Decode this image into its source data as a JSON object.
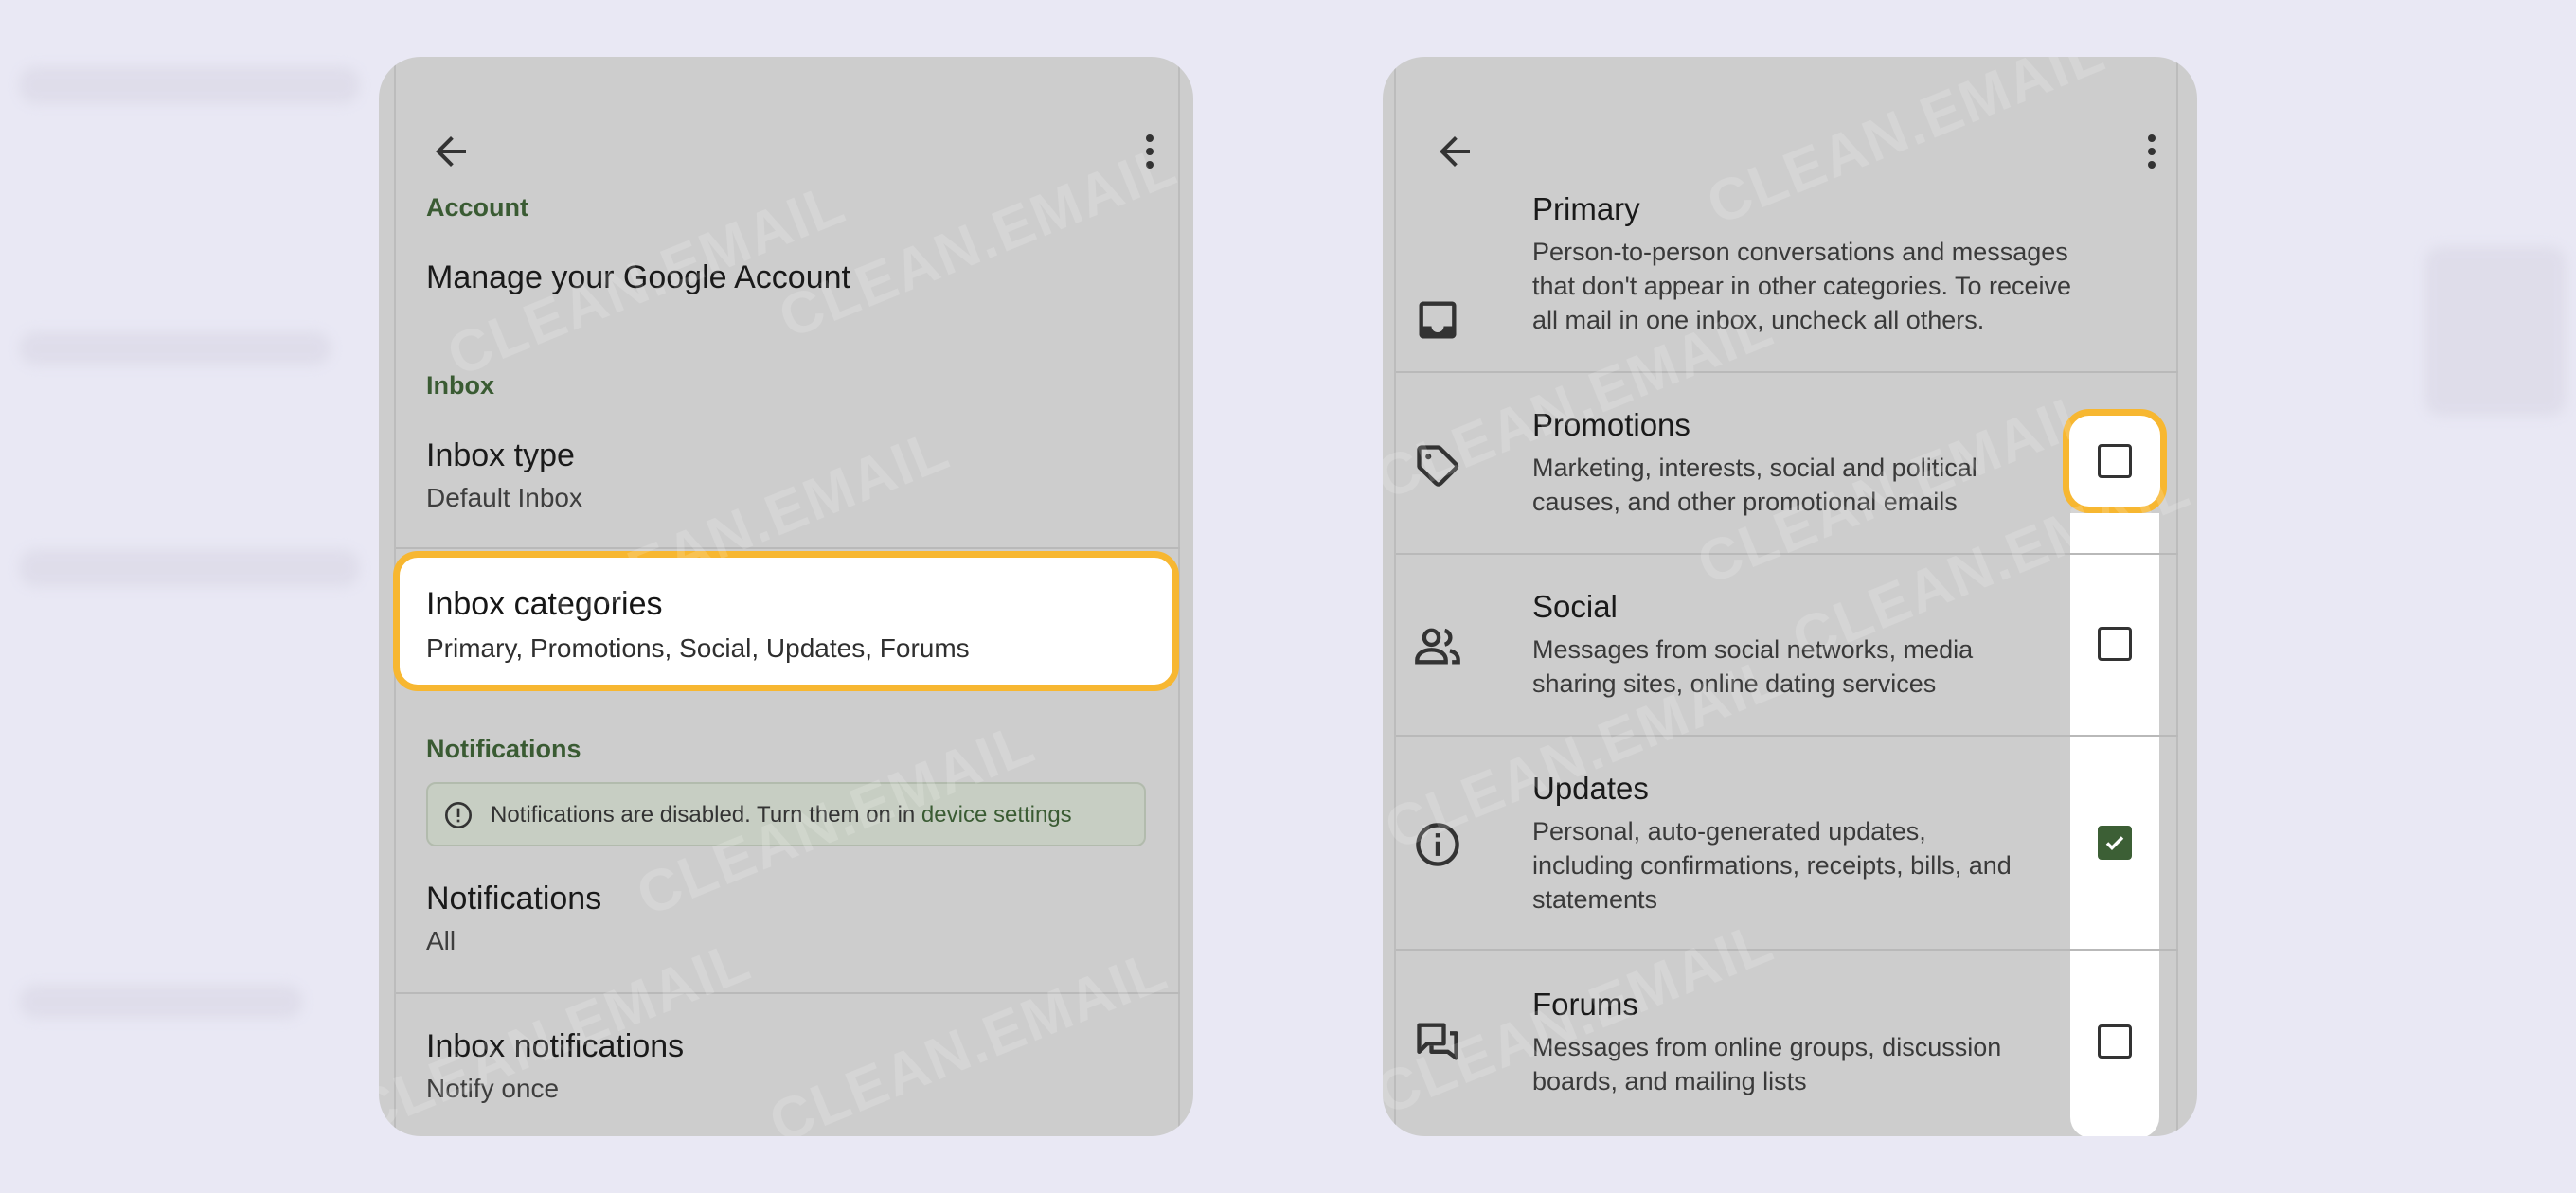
{
  "watermark": "CLEAN.EMAIL",
  "colors": {
    "background": "#e9e8f4",
    "phone": "#cdcdcd",
    "section_label": "#3a5b33",
    "highlight_border": "#f7b731",
    "checkbox_checked": "#3c5f35"
  },
  "left_screen": {
    "icons": {
      "back": "arrow-left-icon",
      "menu": "more-vert-icon"
    },
    "account_section": {
      "label": "Account",
      "manage": "Manage your Google Account"
    },
    "inbox_section": {
      "label": "Inbox",
      "inbox_type": {
        "title": "Inbox type",
        "value": "Default Inbox"
      },
      "inbox_categories": {
        "title": "Inbox categories",
        "value": "Primary, Promotions, Social, Updates, Forums"
      }
    },
    "notifications_section": {
      "label": "Notifications",
      "notice": {
        "text": "Notifications are disabled. Turn them on in ",
        "link": "device settings"
      },
      "notifications": {
        "title": "Notifications",
        "value": "All"
      },
      "inbox_notifications": {
        "title": "Inbox notifications",
        "value": "Notify once"
      }
    }
  },
  "right_screen": {
    "icons": {
      "back": "arrow-left-icon",
      "menu": "more-vert-icon"
    },
    "categories": [
      {
        "icon": "inbox-icon",
        "title": "Primary",
        "desc_lines": [
          "Person-to-person conversations and messages",
          "that don't appear in other categories. To receive",
          "all mail in one inbox, uncheck all others."
        ]
      },
      {
        "icon": "tag-icon",
        "title": "Promotions",
        "desc_lines": [
          "Marketing, interests, social and political",
          "causes, and other promotional emails"
        ],
        "checked": false
      },
      {
        "icon": "people-icon",
        "title": "Social",
        "desc_lines": [
          "Messages from social networks, media",
          "sharing sites, online dating services"
        ],
        "checked": false
      },
      {
        "icon": "info-icon",
        "title": "Updates",
        "desc_lines": [
          "Personal, auto-generated updates,",
          "including confirmations, receipts, bills, and",
          "statements"
        ],
        "checked": true
      },
      {
        "icon": "forum-icon",
        "title": "Forums",
        "desc_lines": [
          "Messages from online groups, discussion",
          "boards, and mailing lists"
        ],
        "checked": false
      }
    ]
  }
}
